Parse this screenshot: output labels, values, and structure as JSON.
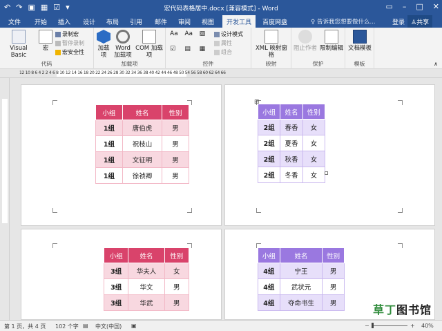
{
  "window": {
    "title": "宏代码表格居中.docx [兼容模式] - Word",
    "quick_access": [
      "save-icon",
      "undo-icon",
      "redo-icon",
      "table-icon",
      "checkbox-icon",
      "dropdown-icon"
    ],
    "controls": [
      "ribbon-display-icon",
      "minimize-icon",
      "maximize-icon",
      "close-icon"
    ]
  },
  "tabs": [
    "文件",
    "开始",
    "插入",
    "设计",
    "布局",
    "引用",
    "邮件",
    "审阅",
    "视图",
    "开发工具",
    "百度网盘"
  ],
  "active_tab": "开发工具",
  "tell_me": "告诉我您想要做什么...",
  "login": "登录",
  "share": "共享",
  "ribbon": {
    "code": {
      "label": "代码",
      "visual_basic": "Visual Basic",
      "macros": "宏",
      "record": "录制宏",
      "pause": "暂停录制",
      "security": "宏安全性"
    },
    "addins": {
      "label": "加载项",
      "addins": "加载项",
      "word_addins": "Word 加载项",
      "com_addins": "COM 加载项"
    },
    "controls": {
      "label": "控件",
      "design_mode": "设计模式",
      "properties": "属性",
      "group": "组合"
    },
    "mapping": {
      "label": "映射",
      "xml_pane": "XML 映射窗格"
    },
    "protect": {
      "label": "保护",
      "block_authors": "阻止作者",
      "restrict_editing": "限制编辑"
    },
    "templates": {
      "label": "模板",
      "document_template": "文档模板"
    }
  },
  "ruler_text": "12 10 8 6 4 2   2  4  6  8 10 12 14 16 18 20 22 24 26 28 30 32 34 36 38 40 42 44 46 48 50    54 56 58 60 62 64 66",
  "tables": [
    {
      "header": [
        "小组",
        "姓名",
        "性别"
      ],
      "rows": [
        [
          "1组",
          "唐伯虎",
          "男"
        ],
        [
          "1组",
          "祝枝山",
          "男"
        ],
        [
          "1组",
          "文征明",
          "男"
        ],
        [
          "1组",
          "徐祯卿",
          "男"
        ]
      ]
    },
    {
      "header": [
        "小组",
        "姓名",
        "性别"
      ],
      "rows": [
        [
          "2组",
          "春香",
          "女"
        ],
        [
          "2组",
          "夏香",
          "女"
        ],
        [
          "2组",
          "秋香",
          "女"
        ],
        [
          "2组",
          "冬香",
          "女"
        ]
      ]
    },
    {
      "header": [
        "小组",
        "姓名",
        "性别"
      ],
      "rows": [
        [
          "3组",
          "华夫人",
          "女"
        ],
        [
          "3组",
          "华文",
          "男"
        ],
        [
          "3组",
          "华武",
          "男"
        ]
      ]
    },
    {
      "header": [
        "小组",
        "姓名",
        "性别"
      ],
      "rows": [
        [
          "4组",
          "宁王",
          "男"
        ],
        [
          "4组",
          "武状元",
          "男"
        ],
        [
          "4组",
          "夺命书生",
          "男"
        ]
      ]
    }
  ],
  "status": {
    "page": "第 1 页，共 4 页",
    "words": "102 个字",
    "language": "中文(中国)",
    "zoom": "40%"
  },
  "watermark": {
    "text_green": "草丁",
    "text_dark": "图书馆"
  },
  "colors": {
    "title_bar": "#2b579a",
    "red_header": "#d9436b",
    "purple_header": "#9a78e0"
  }
}
